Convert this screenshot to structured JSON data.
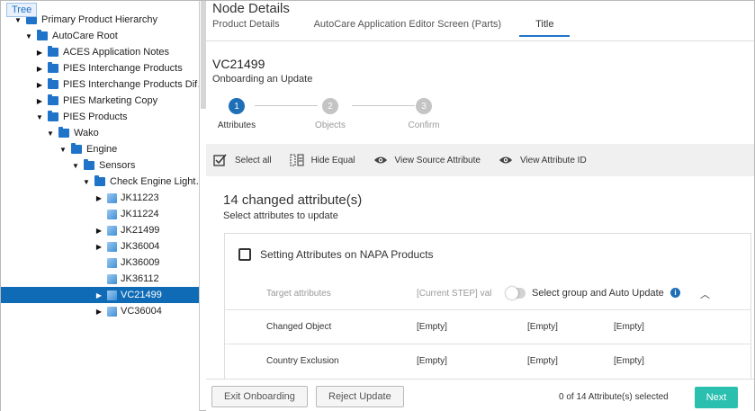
{
  "tree": {
    "tab_label": "Tree",
    "items": [
      {
        "label": "Primary Product Hierarchy",
        "toggle": "▼",
        "icon": "folder-icon"
      },
      {
        "label": "AutoCare Root",
        "toggle": "▼",
        "icon": "folder-icon"
      },
      {
        "label": "ACES Application Notes",
        "toggle": "▶",
        "icon": "folder-icon"
      },
      {
        "label": "PIES Interchange Products",
        "toggle": "▶",
        "icon": "folder-icon"
      },
      {
        "label": "PIES Interchange Products Dif…",
        "toggle": "▶",
        "icon": "folder-icon"
      },
      {
        "label": "PIES Marketing Copy",
        "toggle": "▶",
        "icon": "folder-icon"
      },
      {
        "label": "PIES Products",
        "toggle": "▼",
        "icon": "folder-icon"
      },
      {
        "label": "Wako",
        "toggle": "▼",
        "icon": "folder-icon"
      },
      {
        "label": "Engine",
        "toggle": "▼",
        "icon": "folder-icon"
      },
      {
        "label": "Sensors",
        "toggle": "▼",
        "icon": "folder-icon"
      },
      {
        "label": "Check Engine Light…",
        "toggle": "▼",
        "icon": "folder-icon"
      },
      {
        "label": "JK11223",
        "toggle": "▶",
        "icon": "product-icon"
      },
      {
        "label": "JK11224",
        "toggle": "",
        "icon": "product-icon"
      },
      {
        "label": "JK21499",
        "toggle": "▶",
        "icon": "product-icon"
      },
      {
        "label": "JK36004",
        "toggle": "▶",
        "icon": "product-icon"
      },
      {
        "label": "JK36009",
        "toggle": "",
        "icon": "product-icon"
      },
      {
        "label": "JK36112",
        "toggle": "",
        "icon": "product-icon"
      },
      {
        "label": "VC21499",
        "toggle": "▶",
        "icon": "product-icon",
        "selected": true
      },
      {
        "label": "VC36004",
        "toggle": "▶",
        "icon": "product-icon"
      }
    ]
  },
  "header": {
    "title": "Node Details",
    "tabs": [
      "Product Details",
      "AutoCare Application Editor Screen (Parts)",
      "Title"
    ],
    "active_tab": "Title"
  },
  "product": {
    "id": "VC21499",
    "subtitle": "Onboarding an Update"
  },
  "stepper": {
    "steps": [
      {
        "num": "1",
        "label": "Attributes",
        "active": true
      },
      {
        "num": "2",
        "label": "Objects",
        "active": false
      },
      {
        "num": "3",
        "label": "Confirm",
        "active": false
      }
    ]
  },
  "toolbar": {
    "select_all": "Select all",
    "hide_equal": "Hide Equal",
    "view_source": "View Source Attribute",
    "view_id": "View Attribute ID"
  },
  "changes": {
    "title": "14 changed attribute(s)",
    "subtitle": "Select attributes to update"
  },
  "group": {
    "title": "Setting Attributes on NAPA Products",
    "col_target": "Target attributes",
    "col_current": "[Current STEP] val",
    "auto_update_label": "Select group and Auto Update",
    "rows": [
      {
        "name": "Changed Object",
        "v1": "[Empty]",
        "v2": "[Empty]",
        "v3": "[Empty]"
      },
      {
        "name": "Country Exclusion",
        "v1": "[Empty]",
        "v2": "[Empty]",
        "v3": "[Empty]"
      }
    ]
  },
  "footer": {
    "exit": "Exit Onboarding",
    "reject": "Reject Update",
    "count": "0 of 14 Attribute(s) selected",
    "next": "Next"
  },
  "colors": {
    "accent": "#1f6fb6",
    "next_button": "#2bbfb0",
    "selected_row": "#0f6bb6"
  }
}
